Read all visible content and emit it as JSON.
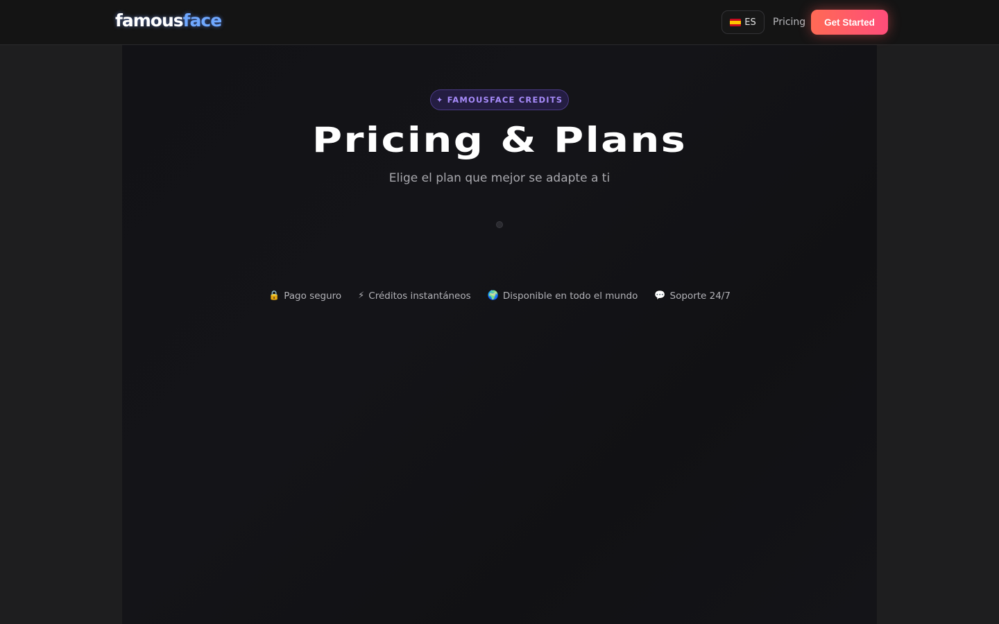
{
  "header": {
    "logo": {
      "part1": "famous",
      "part2": "face"
    },
    "language": {
      "flag_icon": "spain-flag-icon",
      "code": "ES"
    },
    "nav_pricing": "Pricing",
    "cta_label": "Get Started"
  },
  "hero": {
    "badge_icon": "✦",
    "badge_text": "FAMOUSFACE CREDITS",
    "title": "Pricing & Plans",
    "subtitle": "Elige el plan que mejor se adapte a ti"
  },
  "features": [
    {
      "icon": "🔒",
      "icon_name": "lock-icon",
      "label": "Pago seguro"
    },
    {
      "icon": "⚡",
      "icon_name": "lightning-icon",
      "label": "Créditos instantáneos"
    },
    {
      "icon": "🌍",
      "icon_name": "globe-icon",
      "label": "Disponible en todo el mundo"
    },
    {
      "icon": "💬",
      "icon_name": "chat-bubble-icon",
      "label": "Soporte 24/7"
    }
  ],
  "colors": {
    "accent_gradient_start": "#ff6a55",
    "accent_gradient_end": "#ff4d7a",
    "badge_purple": "#a78bfa",
    "logo_blue": "#6fa8ff"
  }
}
